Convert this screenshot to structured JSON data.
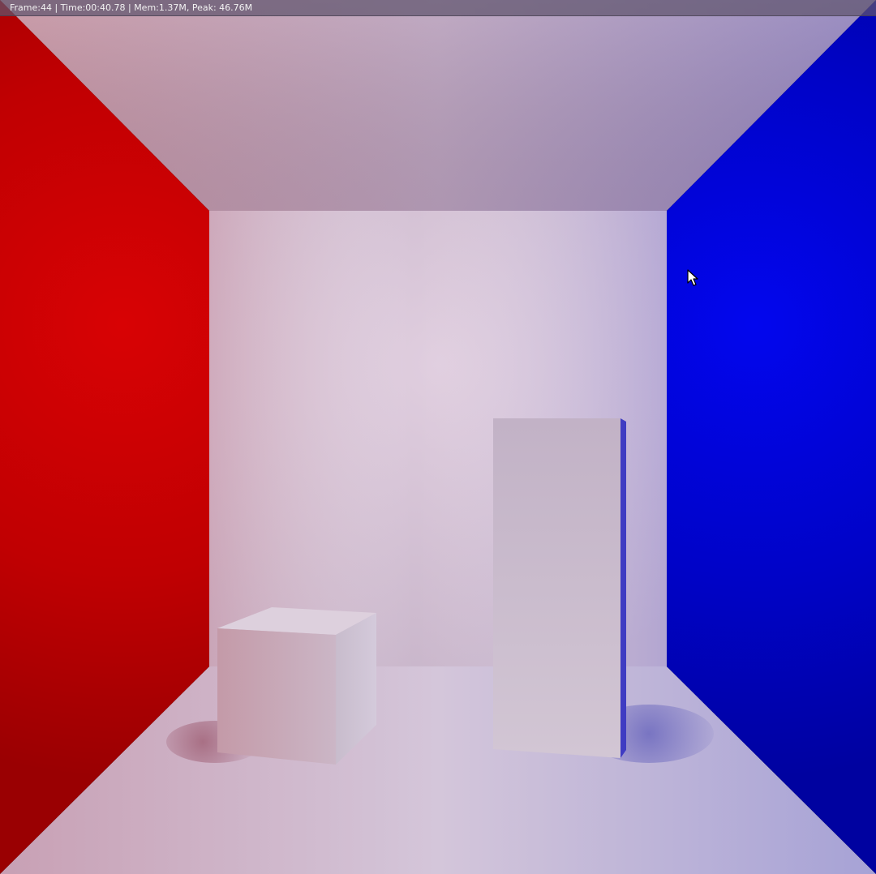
{
  "status": {
    "text": "Frame:44 | Time:00:40.78 | Mem:1.37M, Peak: 46.76M"
  },
  "scene": {
    "left_wall_color": "#cc0000",
    "right_wall_color": "#0000dd",
    "back_wall_color": "#d6c6dc",
    "ceiling_color": "#b8a0be",
    "floor_color": "#d0c4d8",
    "box_color": "#c8b6c8"
  },
  "cursor": {
    "icon": "mouse-pointer-icon"
  }
}
